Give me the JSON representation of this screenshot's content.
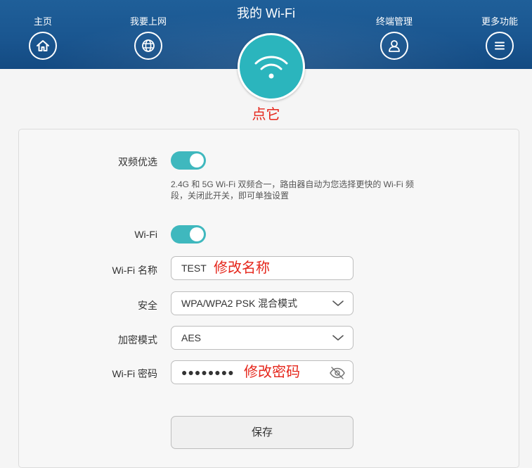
{
  "nav": {
    "home_label": "主页",
    "internet_label": "我要上网",
    "devices_label": "终端管理",
    "more_label": "更多功能"
  },
  "header": {
    "title": "我的 Wi-Fi"
  },
  "annotations": {
    "tap_it": "点它",
    "change_name": "修改名称",
    "change_password": "修改密码"
  },
  "settings": {
    "dual_band": {
      "label": "双频优选",
      "enabled": true,
      "hint": "2.4G 和 5G Wi-Fi 双频合一，路由器自动为您选择更快的 Wi-Fi 频段，关闭此开关，即可单独设置"
    },
    "wifi": {
      "label": "Wi-Fi",
      "enabled": true
    },
    "wifi_name": {
      "label": "Wi-Fi 名称",
      "value": "TEST"
    },
    "security": {
      "label": "安全",
      "value": "WPA/WPA2 PSK 混合模式"
    },
    "encryption": {
      "label": "加密模式",
      "value": "AES"
    },
    "wifi_password": {
      "label": "Wi-Fi 密码",
      "masked_value": "●●●●●●●●"
    }
  },
  "actions": {
    "save_label": "保存"
  },
  "colors": {
    "header": "#1a5690",
    "accent": "#2bb5bd",
    "annotation": "#e5261b"
  },
  "icons": [
    "home-icon",
    "globe-icon",
    "wifi-icon",
    "user-icon",
    "menu-icon",
    "chevron-down-icon",
    "eye-off-icon"
  ]
}
